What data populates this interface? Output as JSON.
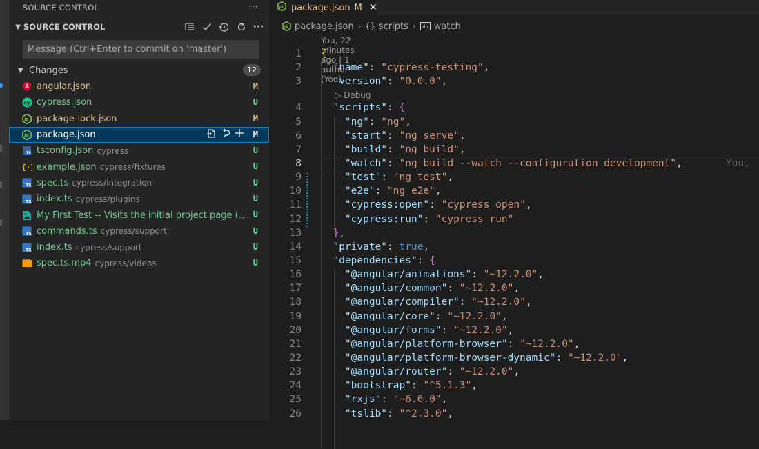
{
  "panel_title": "SOURCE CONTROL",
  "sc": {
    "title": "SOURCE CONTROL",
    "commit_placeholder": "Message (Ctrl+Enter to commit on 'master')",
    "changes_label": "Changes",
    "changes_count": "12"
  },
  "files": [
    {
      "name": "angular.json",
      "dir": "",
      "status": "M",
      "icon": "angular-icon"
    },
    {
      "name": "cypress.json",
      "dir": "",
      "status": "U",
      "icon": "cypress-icon"
    },
    {
      "name": "package-lock.json",
      "dir": "",
      "status": "M",
      "icon": "nodejs-icon"
    },
    {
      "name": "package.json",
      "dir": "",
      "status": "M",
      "icon": "nodejs-icon"
    },
    {
      "name": "tsconfig.json",
      "dir": "cypress",
      "status": "U",
      "icon": "tsconfig-icon"
    },
    {
      "name": "example.json",
      "dir": "cypress/fixtures",
      "status": "U",
      "icon": "json-braces-icon"
    },
    {
      "name": "spec.ts",
      "dir": "cypress/integration",
      "status": "U",
      "icon": "typescript-icon"
    },
    {
      "name": "index.ts",
      "dir": "cypress/plugins",
      "status": "U",
      "icon": "typescript-icon"
    },
    {
      "name": "My First Test -- Visits the initial project page (fa...",
      "dir": "",
      "status": "U",
      "icon": "image-icon"
    },
    {
      "name": "commands.ts",
      "dir": "cypress/support",
      "status": "U",
      "icon": "typescript-icon"
    },
    {
      "name": "index.ts",
      "dir": "cypress/support",
      "status": "U",
      "icon": "typescript-icon"
    },
    {
      "name": "spec.ts.mp4",
      "dir": "cypress/videos",
      "status": "U",
      "icon": "video-icon"
    }
  ],
  "editor": {
    "tab_label": "package.json",
    "tab_flag": "M",
    "breadcrumb": [
      "package.json",
      "scripts",
      "watch"
    ],
    "blame_lens": "You, 22 minutes ago | 1 author (You)",
    "debug_lens": "Debug",
    "inline_blame": "You, ",
    "lines": [
      {
        "n": "1",
        "t": "{"
      },
      {
        "n": "2",
        "t": "\"name\": \"cypress-testing\","
      },
      {
        "n": "3",
        "t": "\"version\": \"0.0.0\","
      },
      {
        "n": "4",
        "t": "\"scripts\": {"
      },
      {
        "n": "5",
        "t": "\"ng\": \"ng\","
      },
      {
        "n": "6",
        "t": "\"start\": \"ng serve\","
      },
      {
        "n": "7",
        "t": "\"build\": \"ng build\","
      },
      {
        "n": "8",
        "t": "\"watch\": \"ng build --watch --configuration development\","
      },
      {
        "n": "9",
        "t": "\"test\": \"ng test\","
      },
      {
        "n": "10",
        "t": "\"e2e\": \"ng e2e\","
      },
      {
        "n": "11",
        "t": "\"cypress:open\": \"cypress open\","
      },
      {
        "n": "12",
        "t": "\"cypress:run\": \"cypress run\""
      },
      {
        "n": "13",
        "t": "},"
      },
      {
        "n": "14",
        "t": "\"private\": true,"
      },
      {
        "n": "15",
        "t": "\"dependencies\": {"
      },
      {
        "n": "16",
        "t": "\"@angular/animations\": \"~12.2.0\","
      },
      {
        "n": "17",
        "t": "\"@angular/common\": \"~12.2.0\","
      },
      {
        "n": "18",
        "t": "\"@angular/compiler\": \"~12.2.0\","
      },
      {
        "n": "19",
        "t": "\"@angular/core\": \"~12.2.0\","
      },
      {
        "n": "20",
        "t": "\"@angular/forms\": \"~12.2.0\","
      },
      {
        "n": "21",
        "t": "\"@angular/platform-browser\": \"~12.2.0\","
      },
      {
        "n": "22",
        "t": "\"@angular/platform-browser-dynamic\": \"~12.2.0\","
      },
      {
        "n": "23",
        "t": "\"@angular/router\": \"~12.2.0\","
      },
      {
        "n": "24",
        "t": "\"bootstrap\": \"^5.1.3\","
      },
      {
        "n": "25",
        "t": "\"rxjs\": \"~6.6.0\","
      },
      {
        "n": "26",
        "t": "\"tslib\": \"^2.3.0\","
      }
    ]
  },
  "colors": {
    "modified": "#e2c08d",
    "untracked": "#73c991",
    "selection": "#04395e",
    "accent": "#007fd4"
  }
}
